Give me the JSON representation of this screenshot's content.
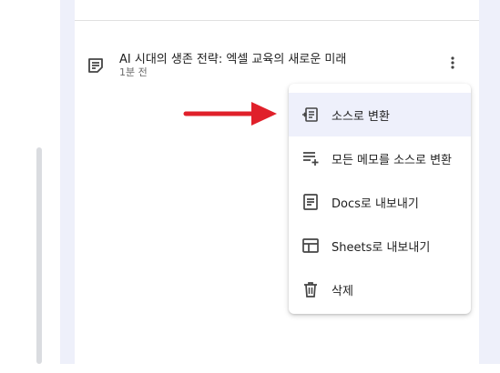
{
  "note": {
    "title": "AI 시대의 생존 전략: 엑셀 교육의 새로운 미래",
    "time": "1분 전"
  },
  "menu": {
    "items": [
      {
        "label": "소스로 변환",
        "icon": "convert-to-source-icon",
        "active": true
      },
      {
        "label": "모든 메모를 소스로 변환",
        "icon": "playlist-add-icon",
        "active": false
      },
      {
        "label": "Docs로 내보내기",
        "icon": "docs-icon",
        "active": false
      },
      {
        "label": "Sheets로 내보내기",
        "icon": "sheets-icon",
        "active": false
      },
      {
        "label": "삭제",
        "icon": "trash-icon",
        "active": false
      }
    ]
  },
  "colors": {
    "panel_bg": "#eef0fa",
    "arrow": "#e0202a",
    "active_item": "#eef0fb"
  }
}
